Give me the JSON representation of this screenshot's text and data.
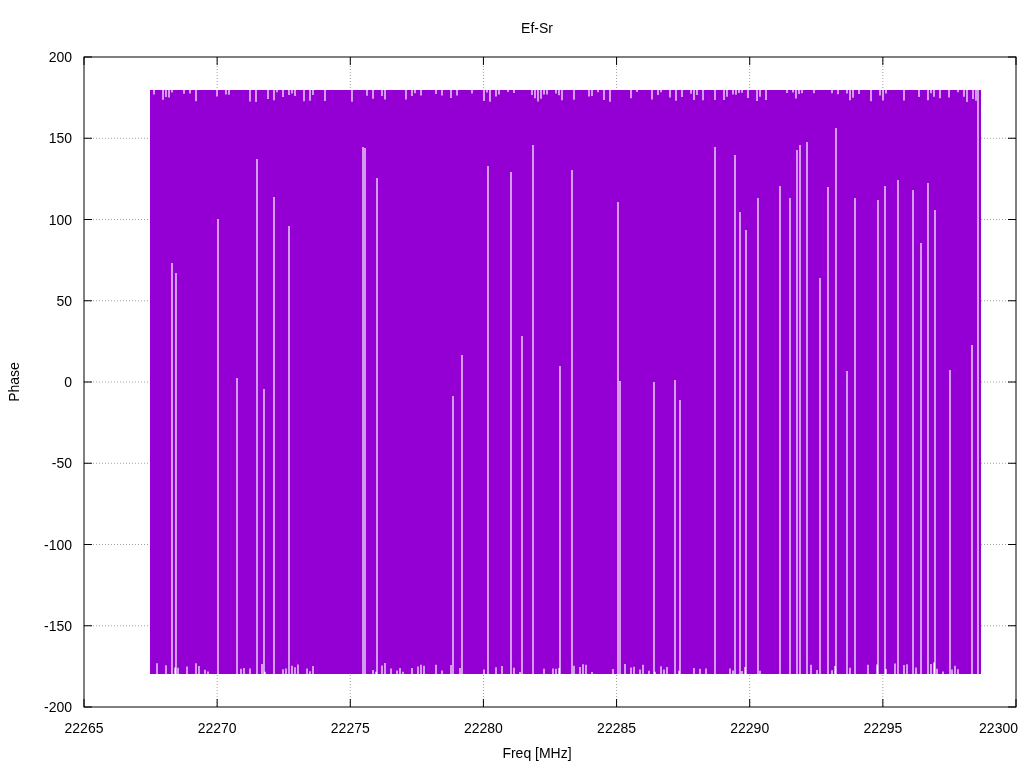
{
  "plot": {
    "title": "Ef-Sr",
    "xlabel": "Freq [MHz]",
    "ylabel": "Phase",
    "xticks": [
      "22265",
      "22270",
      "22275",
      "22280",
      "22285",
      "22290",
      "22295",
      "22300"
    ],
    "yticks": [
      "200",
      "150",
      "100",
      "50",
      "0",
      "-50",
      "-100",
      "-150",
      "-200"
    ]
  }
}
